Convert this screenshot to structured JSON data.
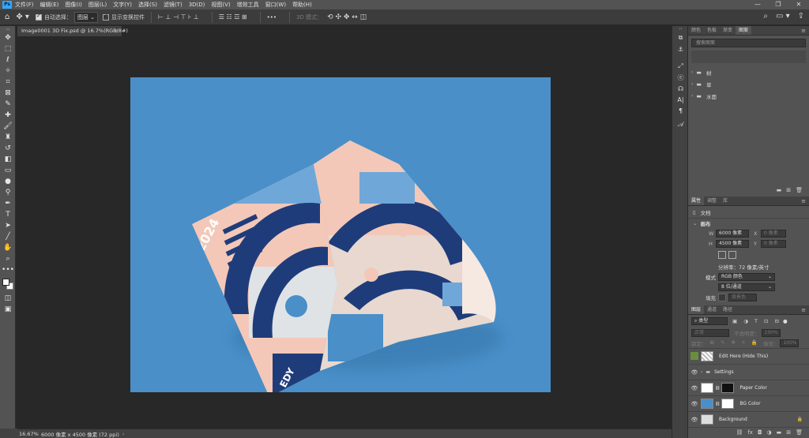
{
  "app": {
    "logo": "Ps"
  },
  "menu": [
    "文件(F)",
    "编辑(E)",
    "图像(I)",
    "图层(L)",
    "文字(Y)",
    "选择(S)",
    "滤镜(T)",
    "3D(D)",
    "视图(V)",
    "增效工具",
    "窗口(W)",
    "帮助(H)"
  ],
  "window_controls": {
    "min": "—",
    "max": "❐",
    "close": "✕"
  },
  "options": {
    "auto_select_label": "自动选择：",
    "auto_select_value": "图层",
    "show_transform_label": "显示变换控件",
    "mode_3d_label": "3D 模式：",
    "more": "•••"
  },
  "doc_tab": {
    "title": "Image0001 3D Fix.psd @ 16.7%(RGB/8#)",
    "close": "×"
  },
  "artwork": {
    "year": "2024",
    "brand": "EDY"
  },
  "status": {
    "zoom": "16.67%",
    "info": "6000 像素 x 4500 像素 (72 ppi)",
    "arrow": "›"
  },
  "panel_top": {
    "tabs": [
      "颜色",
      "色板",
      "渐变",
      "图案"
    ],
    "active_tab": 3,
    "search_placeholder": "搜索图案",
    "groups": [
      "树",
      "草",
      "水面"
    ]
  },
  "properties": {
    "tabs": [
      "属性",
      "调整",
      "库"
    ],
    "active_tab": 0,
    "doc_label": "文档",
    "canvas_title": "画布",
    "w_label": "W",
    "w_value": "6000 像素",
    "x_label": "X",
    "x_value": "0 像素",
    "h_label": "H",
    "h_value": "4500 像素",
    "y_label": "Y",
    "y_value": "0 像素",
    "resolution": "分辨率：72 像素/英寸",
    "mode_label": "模式",
    "mode_value": "RGB 颜色",
    "depth_value": "8 位/通道",
    "fill_label": "填充",
    "fill_value": "背景色"
  },
  "layers_panel": {
    "tabs": [
      "图层",
      "通道",
      "路径"
    ],
    "active_tab": 0,
    "filter_value": "类型",
    "blend_value": "正常",
    "opacity_label": "不透明度：",
    "opacity_value": "100%",
    "lock_label": "锁定：",
    "fill_label": "填充：",
    "fill_value": "100%",
    "layers": [
      {
        "name": "Edit Here (Hide This)",
        "visible": false
      },
      {
        "name": "Settings",
        "visible": true
      },
      {
        "name": "Paper Color",
        "visible": true
      },
      {
        "name": "BG Color",
        "visible": true
      },
      {
        "name": "Background",
        "visible": true
      }
    ]
  },
  "colors": {
    "canvas_bg": "#4a8fc8",
    "navy": "#1f3c7a",
    "peach": "#f3c8b8",
    "ps_blue": "#31a8ff"
  }
}
